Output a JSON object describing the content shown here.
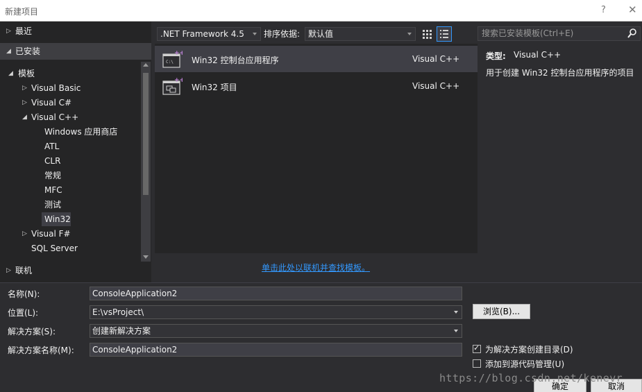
{
  "window": {
    "title": "新建项目",
    "help": "?",
    "close": "✕"
  },
  "sidebar": {
    "recent": "最近",
    "installed": "已安装",
    "online": "联机",
    "tree": [
      {
        "label": "模板"
      },
      {
        "label": "Visual Basic"
      },
      {
        "label": "Visual C#"
      },
      {
        "label": "Visual C++"
      },
      {
        "label": "Windows 应用商店"
      },
      {
        "label": "ATL"
      },
      {
        "label": "CLR"
      },
      {
        "label": "常规"
      },
      {
        "label": "MFC"
      },
      {
        "label": "测试"
      },
      {
        "label": "Win32"
      },
      {
        "label": "Visual F#"
      },
      {
        "label": "SQL Server"
      }
    ]
  },
  "toolbar": {
    "framework": ".NET Framework 4.5",
    "sort_label": "排序依据:",
    "sort_value": "默认值",
    "search_placeholder": "搜索已安装模板(Ctrl+E)"
  },
  "templates": [
    {
      "name": "Win32 控制台应用程序",
      "lang": "Visual C++",
      "icon": "console-app-icon",
      "selected": true
    },
    {
      "name": "Win32 项目",
      "lang": "Visual C++",
      "icon": "win32-project-icon",
      "selected": false
    }
  ],
  "details": {
    "type_label": "类型:",
    "type_value": "Visual C++",
    "description": "用于创建 Win32 控制台应用程序的项目"
  },
  "online_link": "单击此处以联机并查找模板。",
  "form": {
    "name_label": "名称(N):",
    "name_value": "ConsoleApplication2",
    "location_label": "位置(L):",
    "location_value": "E:\\vsProject\\",
    "solution_label": "解决方案(S):",
    "solution_value": "创建新解决方案",
    "solution_name_label": "解决方案名称(M):",
    "solution_name_value": "ConsoleApplication2",
    "browse": "浏览(B)...",
    "create_dir": "为解决方案创建目录(D)",
    "create_dir_checked": true,
    "add_source_control": "添加到源代码管理(U)",
    "add_source_control_checked": false,
    "ok": "确定",
    "cancel": "取消"
  },
  "watermark": "https://blog.csdn.net/kenevr",
  "colors": {
    "accent": "#3399ff",
    "background": "#2d2d30",
    "panel": "#252526",
    "selected": "#3f3f46"
  }
}
